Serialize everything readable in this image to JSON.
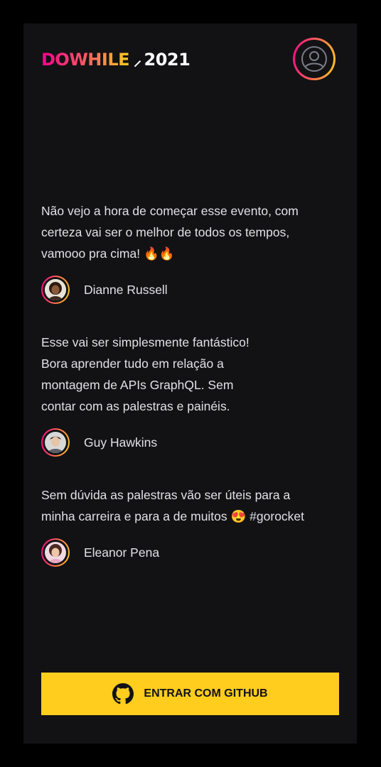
{
  "header": {
    "logo_text": "DOWHILE",
    "logo_year": "2021",
    "avatar_icon": "user-circle-icon"
  },
  "messages": [
    {
      "lines": [
        "Não vejo a hora de começar esse evento, com",
        "certeza vai ser o melhor de todos os tempos,",
        "vamooo pra cima! 🔥🔥"
      ],
      "author": "Dianne Russell"
    },
    {
      "lines": [
        "Esse vai ser simplesmente fantástico!",
        "Bora aprender tudo em relação a",
        "montagem de APIs GraphQL. Sem",
        "contar com as palestras e painéis."
      ],
      "author": "Guy Hawkins"
    },
    {
      "lines": [
        "Sem dúvida as palestras vão ser úteis para a",
        "minha carreira e para a de muitos 😍 #gorocket"
      ],
      "author": "Eleanor Pena"
    }
  ],
  "login_button": {
    "label": "ENTRAR COM GITHUB",
    "icon": "github-icon"
  },
  "colors": {
    "background": "#121214",
    "text": "#e1e1e6",
    "gradient_start": "#ff008e",
    "gradient_end": "#ffcd1e",
    "button": "#ffcd1e"
  }
}
